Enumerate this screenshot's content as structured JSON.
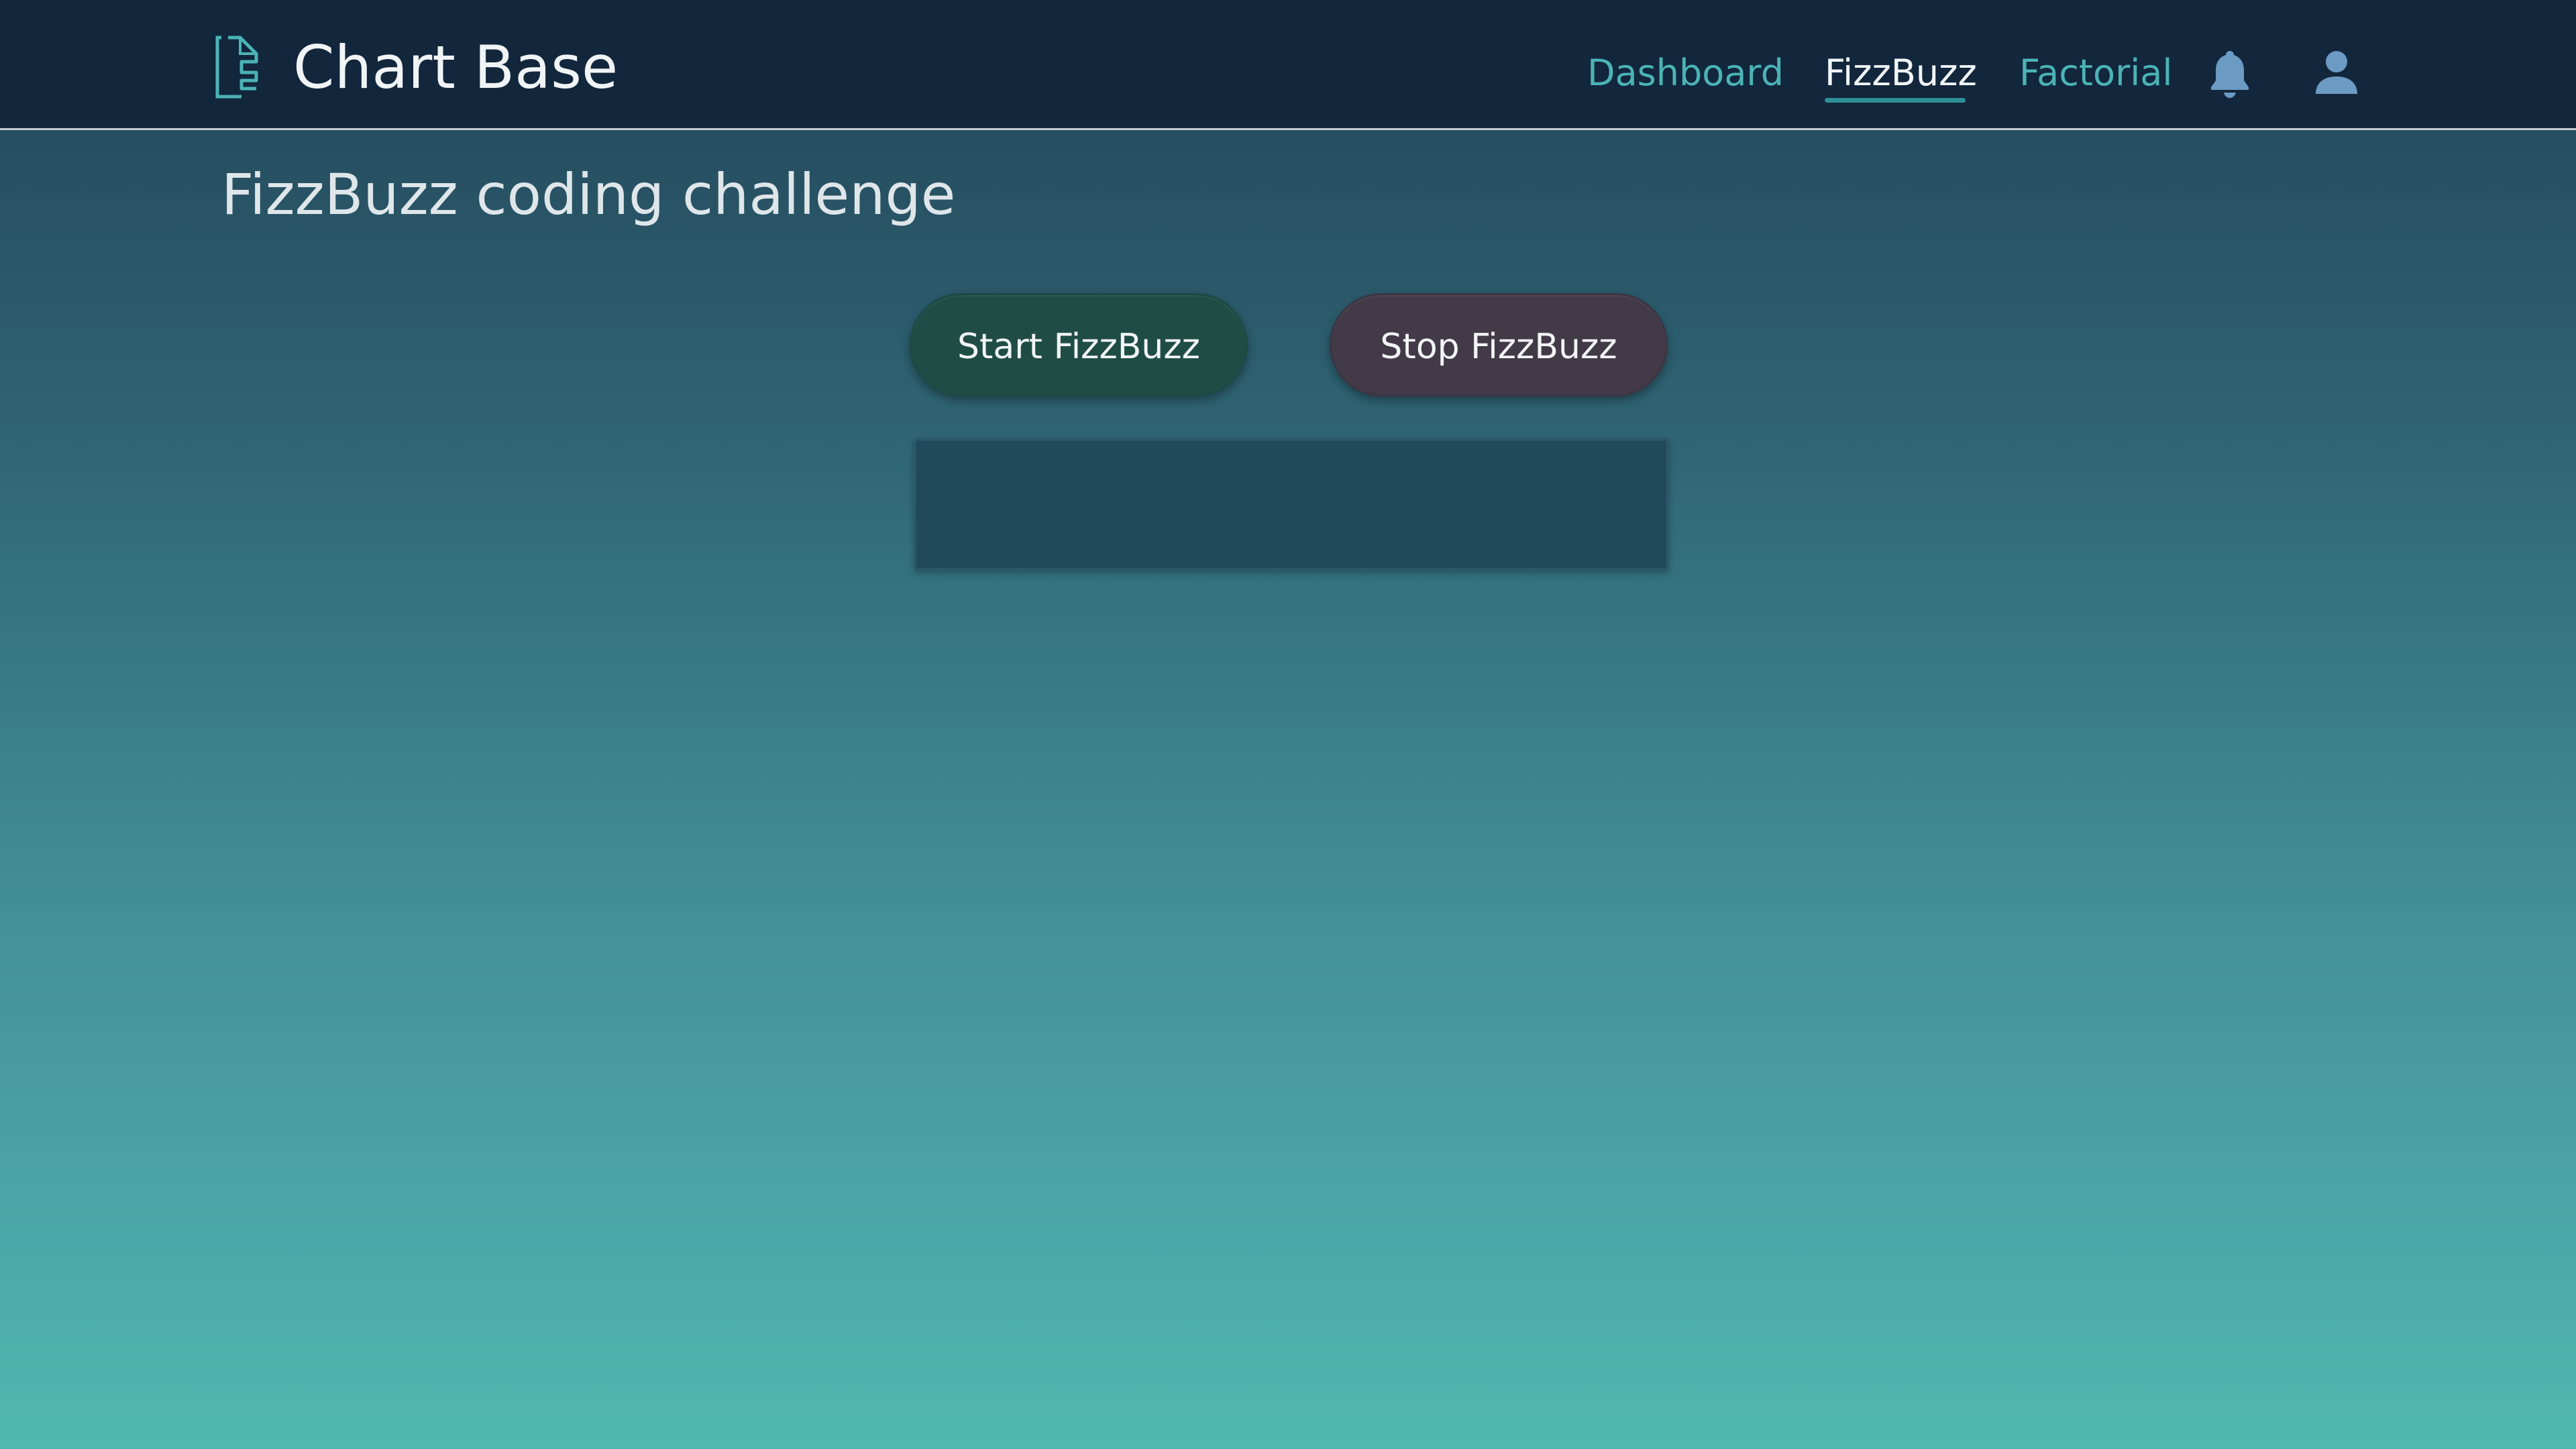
{
  "header": {
    "app_title": "Chart Base",
    "logo_icon": "document-bracket-icon",
    "nav": [
      {
        "label": "Dashboard",
        "active": false
      },
      {
        "label": "FizzBuzz",
        "active": true
      },
      {
        "label": "Factorial",
        "active": false
      }
    ],
    "icons": [
      "bell-icon",
      "user-icon"
    ]
  },
  "main": {
    "title": "FizzBuzz coding challenge",
    "start_label": "Start FizzBuzz",
    "stop_label": "Stop FizzBuzz",
    "output": ""
  },
  "colors": {
    "header_bg": "#12263c",
    "nav_link": "#4bb3b6",
    "nav_active": "#f2f5f7",
    "start_button": "#1f4d45",
    "stop_button": "#433a48",
    "output_bg": "#20495a"
  }
}
